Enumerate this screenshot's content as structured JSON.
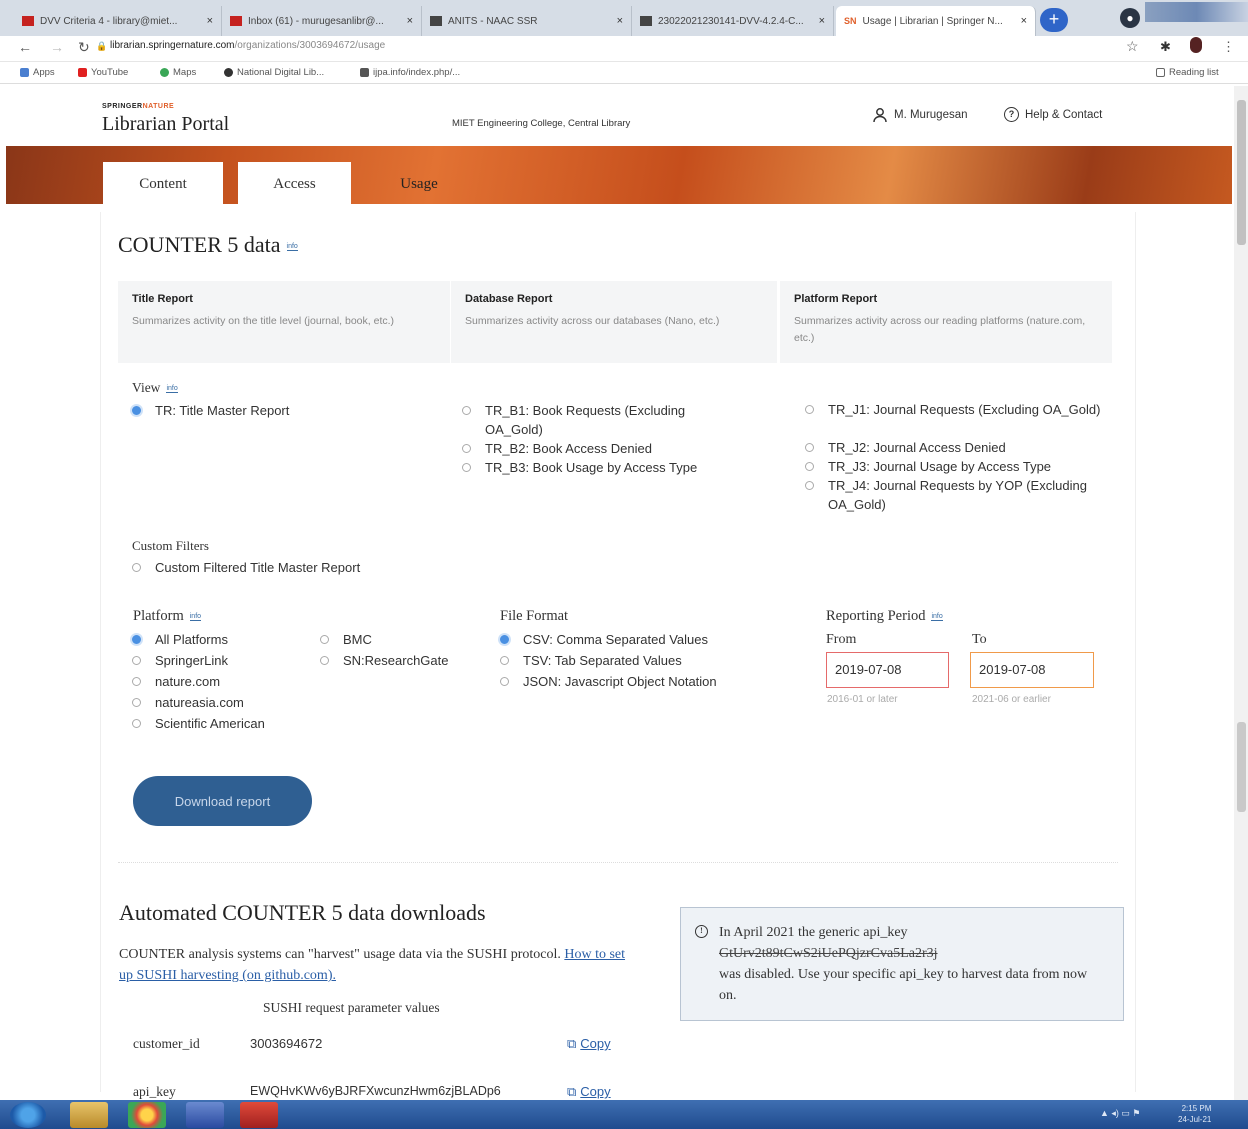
{
  "browser": {
    "tabs": [
      {
        "label": "DVV Criteria 4 - library@miet...",
        "active": false
      },
      {
        "label": "Inbox (61) - murugesanlibr@...",
        "active": false
      },
      {
        "label": "ANITS - NAAC SSR",
        "active": false
      },
      {
        "label": "23022021230141-DVV-4.2.4-C...",
        "active": false
      },
      {
        "label": "Usage | Librarian | Springer N...",
        "active": true
      }
    ],
    "url_host": "librarian.springernature.com",
    "url_path": "/organizations/3003694672/usage",
    "bookmarks": [
      "Apps",
      "YouTube",
      "Maps",
      "National Digital Lib...",
      "ijpa.info/index.php/..."
    ],
    "reading_list": "Reading list"
  },
  "header": {
    "brand_small_a": "SPRINGER",
    "brand_small_b": "NATURE",
    "title": "Librarian Portal",
    "institution": "MIET Engineering College, Central Library",
    "user": "M. Murugesan",
    "help": "Help & Contact"
  },
  "tabs": [
    "Content",
    "Access",
    "Usage"
  ],
  "counter": {
    "heading": "COUNTER 5 data",
    "info": "info",
    "reports": [
      {
        "title": "Title Report",
        "desc": "Summarizes activity on the title level (journal, book, etc.)"
      },
      {
        "title": "Database Report",
        "desc": "Summarizes activity across our databases (Nano, etc.)"
      },
      {
        "title": "Platform Report",
        "desc": "Summarizes activity across our reading platforms (nature.com, etc.)"
      }
    ],
    "view_label": "View",
    "view_options_col1": [
      "TR: Title Master Report"
    ],
    "view_options_col2": [
      "TR_B1: Book Requests (Excluding OA_Gold)",
      "TR_B2: Book Access Denied",
      "TR_B3: Book Usage by Access Type"
    ],
    "view_options_col3": [
      "TR_J1: Journal Requests (Excluding OA_Gold)",
      "TR_J2: Journal Access Denied",
      "TR_J3: Journal Usage by Access Type",
      "TR_J4: Journal Requests by YOP (Excluding OA_Gold)"
    ],
    "custom_filters_label": "Custom Filters",
    "custom_filter_option": "Custom Filtered Title Master Report",
    "platform_label": "Platform",
    "platforms_col1": [
      "All Platforms",
      "SpringerLink",
      "nature.com",
      "natureasia.com",
      "Scientific American"
    ],
    "platforms_col2": [
      "BMC",
      "SN:ResearchGate"
    ],
    "file_format_label": "File Format",
    "file_formats": [
      "CSV: Comma Separated Values",
      "TSV: Tab Separated Values",
      "JSON: Javascript Object Notation"
    ],
    "reporting_period_label": "Reporting Period",
    "from_label": "From",
    "to_label": "To",
    "from_value": "2019-07-08",
    "to_value": "2019-07-08",
    "from_hint": "2016-01 or later",
    "to_hint": "2021-06 or earlier",
    "download_button": "Download report"
  },
  "automated": {
    "heading": "Automated COUNTER 5 data downloads",
    "desc_text": "COUNTER analysis systems can \"harvest\" usage data via the SUSHI protocol.",
    "desc_link": "How to set up SUSHI harvesting (on github.com).",
    "params_heading": "SUSHI request parameter values",
    "customer_id_label": "customer_id",
    "customer_id": "3003694672",
    "api_key_label": "api_key",
    "api_key": "EWQHvKWv6yBJRFXwcunzHwm6zjBLADp6",
    "copy": "Copy",
    "notice_line1": "In April 2021 the generic api_key",
    "notice_old_key": "GtUrv2t89tCwS2iUePQjzrCva5La2r3j",
    "notice_line2": "was disabled. Use your specific api_key to harvest data from now on."
  },
  "taskbar": {
    "time": "2:15 PM",
    "date": "24-Jul-21"
  }
}
